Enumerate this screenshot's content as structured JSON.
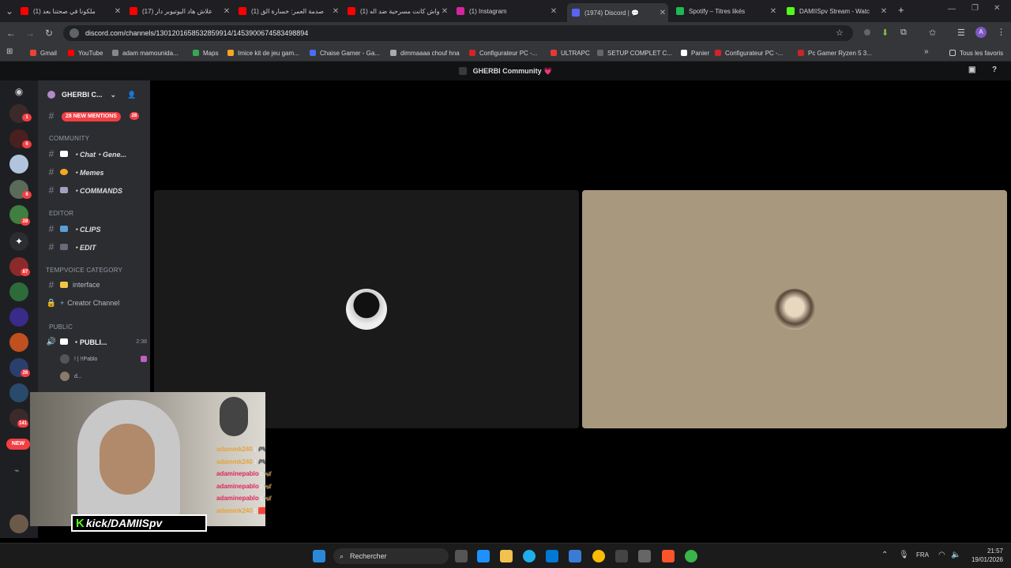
{
  "browser": {
    "tabs": [
      {
        "title": "(1) ملكونا في صحتنا بعد",
        "close": "✕",
        "color": "#ff0000"
      },
      {
        "title": "(17) علاش هاد اليوتيوبر دار",
        "close": "✕",
        "color": "#ff0000"
      },
      {
        "title": "(1) صدمة العمر: خسارة الق",
        "close": "✕",
        "color": "#ff0000"
      },
      {
        "title": "(1) واش كانت مسرحية ضد اله",
        "close": "✕",
        "color": "#ff0000"
      },
      {
        "title": "(1) Instagram",
        "close": "✕",
        "color": "#d6249f"
      },
      {
        "title": "(1974) Discord | 💬",
        "close": "✕",
        "color": "#5865f2"
      },
      {
        "title": "Spotify – Titres likés",
        "close": "✕",
        "color": "#1db954"
      },
      {
        "title": "DAMIISpv Stream - Watc",
        "close": "✕",
        "color": "#53fc18"
      }
    ],
    "new_tab": "+",
    "url": "discord.com/channels/1301201658532859914/1453900674583498894",
    "bookmarks": [
      {
        "label": "Gmail",
        "color": "#ea4335"
      },
      {
        "label": "YouTube",
        "color": "#ff0000"
      },
      {
        "label": "adam mamounida...",
        "color": "#888888"
      },
      {
        "label": "Maps",
        "color": "#34a853"
      },
      {
        "label": "Imice kit de jeu gam...",
        "color": "#f5a623"
      },
      {
        "label": "Chaise Gamer - Ga...",
        "color": "#4a6cf7"
      },
      {
        "label": "dimmaaaa chouf hna",
        "color": "#aaaaaa"
      },
      {
        "label": "Configurateur PC -...",
        "color": "#d2232a"
      },
      {
        "label": "ULTRAPC",
        "color": "#e53935"
      },
      {
        "label": "SETUP COMPLET C...",
        "color": "#666666"
      },
      {
        "label": "Panier",
        "color": "#ffffff"
      },
      {
        "label": "Configurateur PC -...",
        "color": "#d2232a"
      },
      {
        "label": "Pc Gamer Ryzen 5 3...",
        "color": "#c62828"
      }
    ],
    "all_bookmarks": "Tous les favoris"
  },
  "discord": {
    "title": "GHERBI Community 💗",
    "server_name": "GHERBI C...",
    "mentions_pill": "28 NEW MENTIONS",
    "mentions_count": "28",
    "categories": {
      "community": "COMMUNITY",
      "editor": "EDITOR",
      "tempvoice": "TEMPVOICE CATEGORY",
      "public": "PUBLIC"
    },
    "channels": {
      "chat": "・Chat・Gene...",
      "memes": "・Memes",
      "commands": "・COMMANDS",
      "clips": "・CLIPS",
      "edit": "・EDIT",
      "interface": "interface",
      "creator": "Creator Channel",
      "public_voice": "・PUBLI...",
      "public_time": "2:38"
    },
    "voice_users": [
      "! | !!Pablo",
      "d..."
    ],
    "server_badges": [
      "1",
      "6",
      "6",
      "28",
      "87",
      "26",
      "141",
      "NEW"
    ]
  },
  "overlay": {
    "brand": "kick/DAMIISpv",
    "chat": [
      {
        "user": "adammk240",
        "msg": ": 🎮",
        "color": "#e6a23c"
      },
      {
        "user": "adammk240",
        "msg": ": 🎮",
        "color": "#e6a23c"
      },
      {
        "user": "adaminepablo",
        "msg": ": 🦋",
        "color": "#e0245e"
      },
      {
        "user": "adaminepablo",
        "msg": ": 🦋",
        "color": "#e0245e"
      },
      {
        "user": "adaminepablo",
        "msg": ": 🦋",
        "color": "#e0245e"
      },
      {
        "user": "adammk240",
        "msg": ": 🟥",
        "color": "#e6a23c"
      }
    ]
  },
  "taskbar": {
    "search": "Rechercher",
    "lang": "FRA",
    "time": "21:57",
    "date": "19/01/2026"
  }
}
